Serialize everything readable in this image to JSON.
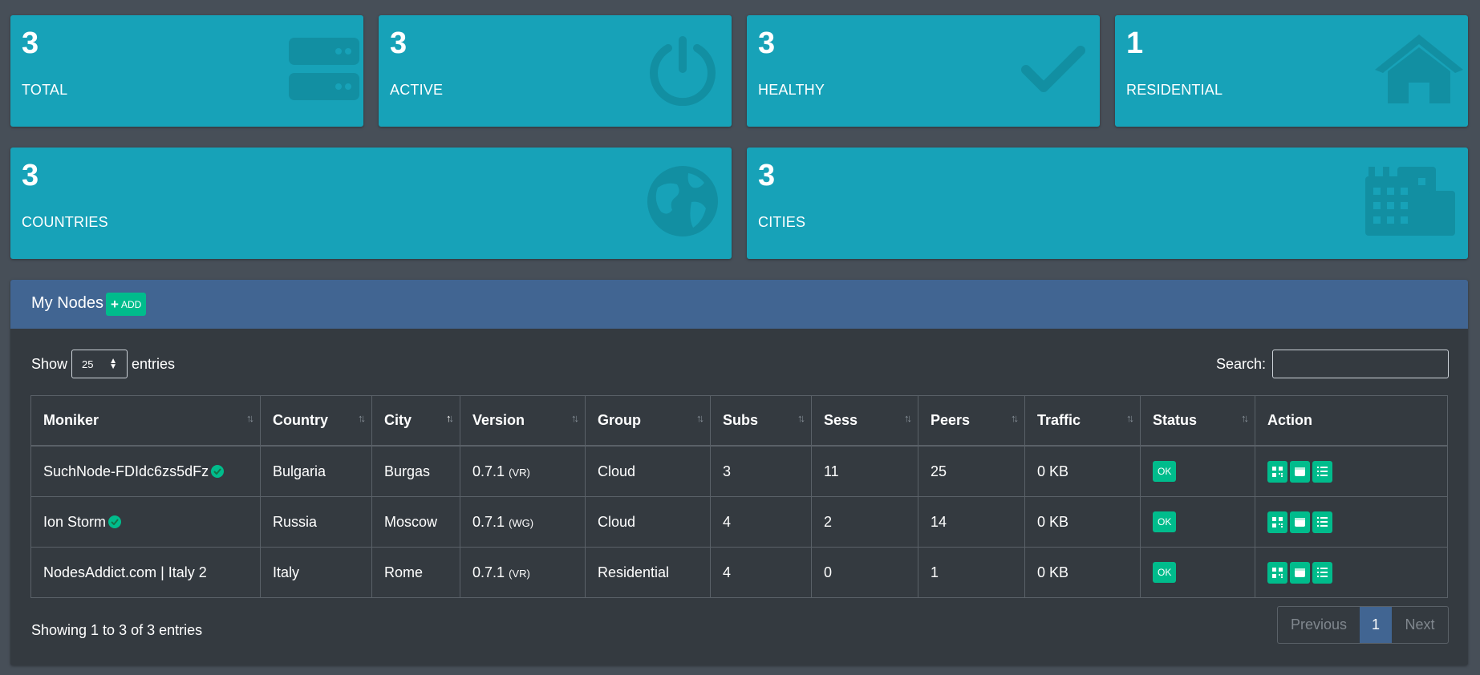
{
  "stats": [
    {
      "value": "3",
      "label": "TOTAL",
      "icon": "server-icon"
    },
    {
      "value": "3",
      "label": "ACTIVE",
      "icon": "power-icon"
    },
    {
      "value": "3",
      "label": "HEALTHY",
      "icon": "check-icon"
    },
    {
      "value": "1",
      "label": "RESIDENTIAL",
      "icon": "home-icon"
    },
    {
      "value": "3",
      "label": "COUNTRIES",
      "icon": "globe-icon"
    },
    {
      "value": "3",
      "label": "CITIES",
      "icon": "city-icon"
    }
  ],
  "colors": {
    "card": "#17a2b8",
    "panel_header": "#416592",
    "success": "#00bc8c",
    "page_bg": "#474f58",
    "panel_bg": "#343a40"
  },
  "panel": {
    "title": "My Nodes",
    "add_label": "ADD"
  },
  "length": {
    "show": "Show",
    "value": "25",
    "entries": "entries"
  },
  "search": {
    "label": "Search:"
  },
  "table": {
    "columns": [
      "Moniker",
      "Country",
      "City",
      "Version",
      "Group",
      "Subs",
      "Sess",
      "Peers",
      "Traffic",
      "Status",
      "Action"
    ],
    "sorted_column": "City",
    "rows": [
      {
        "moniker": "SuchNode-FDIdc6zs5dFz",
        "verified": true,
        "country": "Bulgaria",
        "city": "Burgas",
        "version": "0.7.1",
        "ver_type": "(VR)",
        "group": "Cloud",
        "subs": "3",
        "sess": "11",
        "peers": "25",
        "traffic": "0 KB",
        "status": "OK"
      },
      {
        "moniker": "Ion Storm",
        "verified": true,
        "country": "Russia",
        "city": "Moscow",
        "version": "0.7.1",
        "ver_type": "(WG)",
        "group": "Cloud",
        "subs": "4",
        "sess": "2",
        "peers": "14",
        "traffic": "0 KB",
        "status": "OK"
      },
      {
        "moniker": "NodesAddict.com | Italy 2",
        "verified": false,
        "country": "Italy",
        "city": "Rome",
        "version": "0.7.1",
        "ver_type": "(VR)",
        "group": "Residential",
        "subs": "4",
        "sess": "0",
        "peers": "1",
        "traffic": "0 KB",
        "status": "OK"
      }
    ]
  },
  "footer": {
    "info": "Showing 1 to 3 of 3 entries",
    "previous": "Previous",
    "page": "1",
    "next": "Next"
  }
}
